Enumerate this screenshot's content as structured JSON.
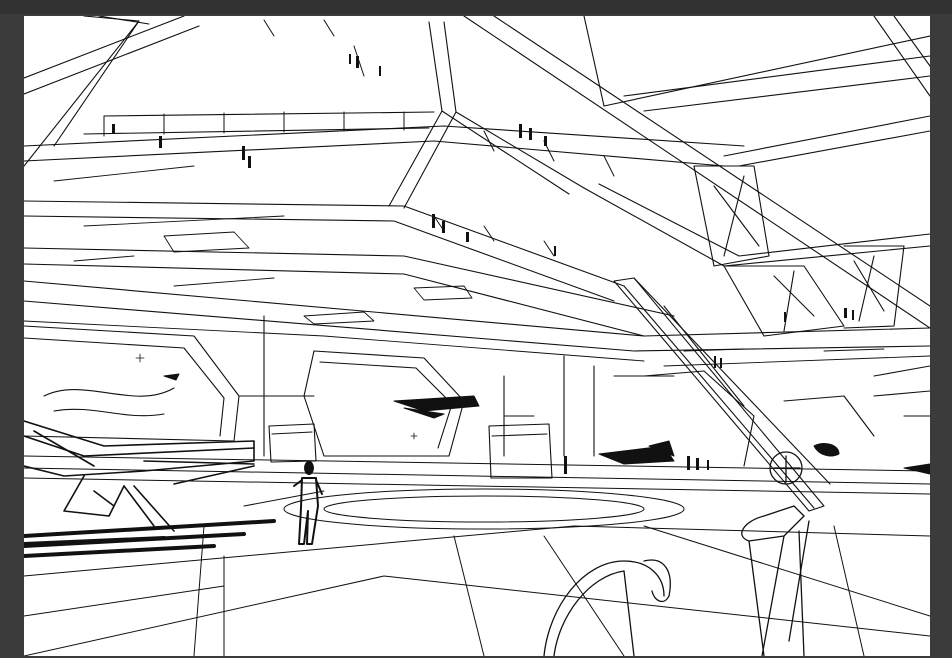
{
  "artwork": {
    "kind": "line-sketch",
    "palette": {
      "background": "#3b3b3b",
      "topbar": "#323232",
      "paper": "#ffffff",
      "ink": "#111111"
    }
  }
}
